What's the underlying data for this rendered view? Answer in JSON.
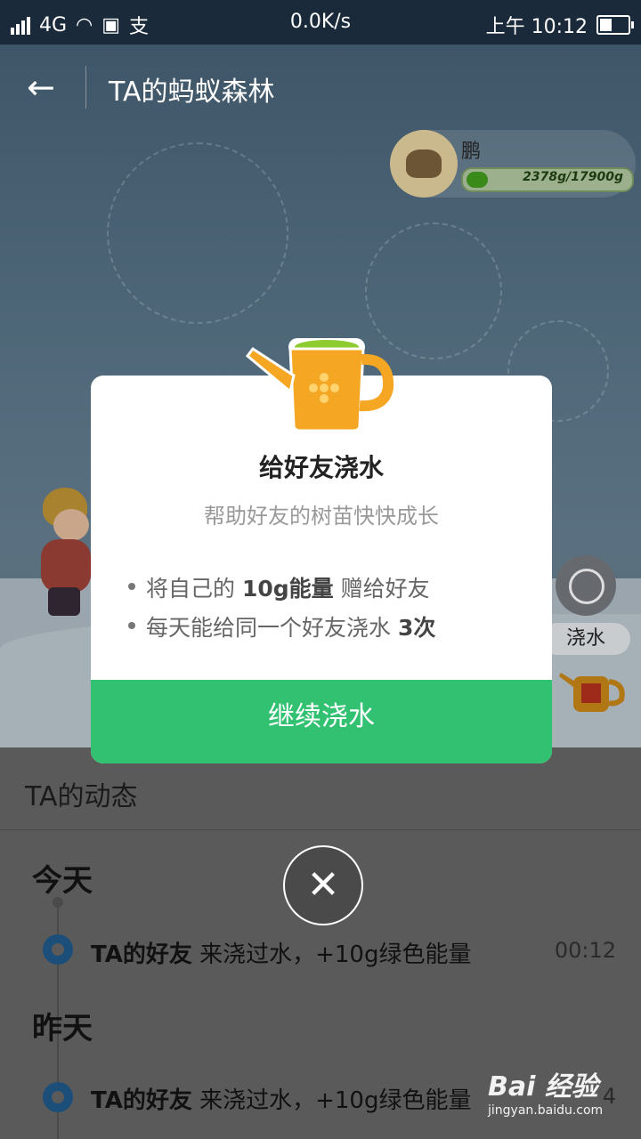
{
  "status": {
    "network": "4G",
    "alipay_glyph": "支",
    "speed": "0.0K/s",
    "time": "上午 10:12",
    "battery_level": 0.5
  },
  "header": {
    "title": "TA的蚂蚁森林"
  },
  "user": {
    "name": "鹏",
    "energy_text": "2378g/17900g",
    "energy_fraction": 0.133
  },
  "side": {
    "water_label": "浇水"
  },
  "dialog": {
    "title": "给好友浇水",
    "subtitle": "帮助好友的树苗快快成长",
    "bullet1_pre": "将自己的 ",
    "bullet1_bold": "10g能量",
    "bullet1_post": " 赠给好友",
    "bullet2_pre": "每天能给同一个好友浇水 ",
    "bullet2_bold": "3次",
    "cta": "继续浇水"
  },
  "feed": {
    "heading": "TA的动态",
    "today": "今天",
    "yesterday": "昨天",
    "items": [
      {
        "actor": "TA的好友",
        "text": " 来浇过水，+10g绿色能量",
        "time": "00:12"
      },
      {
        "actor": "TA的好友",
        "text": " 来浇过水，+10g绿色能量",
        "time": "4"
      }
    ]
  },
  "watermark": {
    "brand": "Bai  经验",
    "url": "jingyan.baidu.com"
  },
  "icons": {
    "back": "arrow-left-icon",
    "close": "close-icon",
    "message": "chat-bubble-icon",
    "watering_can": "watering-can-icon"
  },
  "colors": {
    "cta_green": "#31c171",
    "ring_blue": "#1b4e78",
    "can_orange": "#f5a623"
  }
}
